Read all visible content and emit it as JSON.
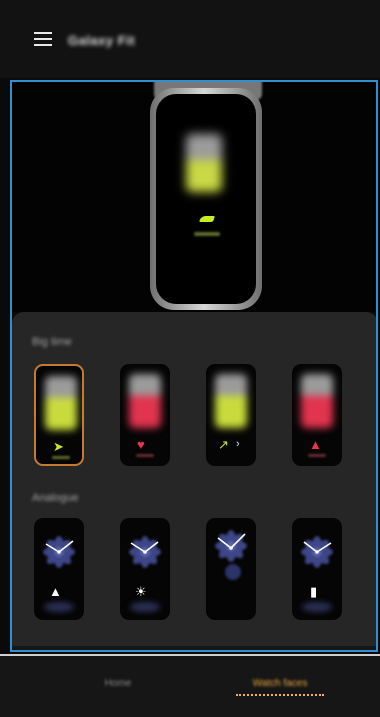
{
  "header": {
    "title": "Galaxy Fit",
    "menu_icon": "hamburger-menu-icon"
  },
  "preview": {
    "selected_face": "Big time",
    "icon": "running-shoe-icon",
    "accent": "#c9e22a"
  },
  "panel": {
    "sections": [
      {
        "title": "Big time",
        "items": [
          {
            "name": "big-time-steps",
            "icon": "shoe",
            "glyph": "➤",
            "color": "#c9e22a",
            "selected": true
          },
          {
            "name": "big-time-heart",
            "icon": "heart",
            "glyph": "♥",
            "color": "#e8344f"
          },
          {
            "name": "big-time-exercise",
            "icon": "runner",
            "glyph": "🏃",
            "color": "#c9e22a"
          },
          {
            "name": "big-time-calories",
            "icon": "flame",
            "glyph": "▲",
            "color": "#e8344f"
          }
        ]
      },
      {
        "title": "Analogue",
        "items": [
          {
            "name": "analogue-calories",
            "icon": "flame",
            "glyph": "▲"
          },
          {
            "name": "analogue-weather",
            "icon": "sun",
            "glyph": "☀"
          },
          {
            "name": "analogue-plain",
            "icon": "none",
            "glyph": ""
          },
          {
            "name": "analogue-battery",
            "icon": "battery",
            "glyph": "▮"
          }
        ]
      }
    ]
  },
  "bottom_nav": {
    "tabs": [
      {
        "label": "Home",
        "active": false
      },
      {
        "label": "Watch faces",
        "active": true
      }
    ]
  },
  "colors": {
    "selection_border": "#2f8fd2",
    "selected_tile": "#c47a2f",
    "active_tab": "#e9a63d"
  }
}
